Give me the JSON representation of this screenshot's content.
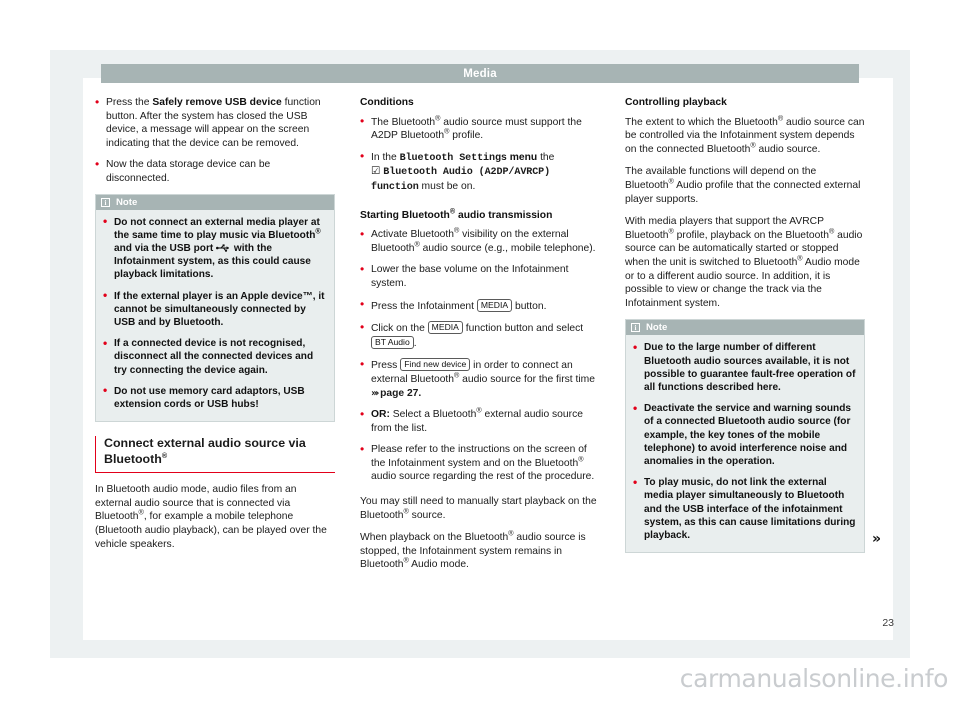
{
  "header": {
    "title": "Media"
  },
  "page_number": "23",
  "watermark": "carmanualsonline.info",
  "column_left": {
    "bullets": [
      {
        "pre": "Press the ",
        "bold": "Safely remove USB device",
        "post": " function button. After the system has closed the USB device, a message will appear on the screen indicating that the device can be removed."
      },
      {
        "pre": "Now the data storage device can be disconnected.",
        "bold": "",
        "post": ""
      }
    ],
    "note": {
      "label": "Note",
      "icon": "info-icon",
      "bullets": [
        "Do not connect an external media player at the same time to play music via Bluetooth® and via the USB port ⎇ with the Infotainment system, as this could cause playback limitations.",
        "If the external player is an Apple device™, it cannot be simultaneously connected by USB and by Bluetooth.",
        "If a connected device is not recognised, disconnect all the connected devices and try connecting the device again.",
        "Do not use memory card adaptors, USB extension cords or USB hubs!"
      ]
    },
    "section": {
      "heading": "Connect external audio source via Bluetooth®",
      "paragraph": "In Bluetooth audio mode, audio files from an external audio source that is connected via Bluetooth®, for example a mobile telephone (Bluetooth audio playback), can be played over the vehicle speakers."
    }
  },
  "column_middle": {
    "conditions_heading": "Conditions",
    "conditions_bullets": [
      "The Bluetooth® audio source must support the A2DP Bluetooth® profile.",
      "In the Bluetooth Settings menu the ☑ Bluetooth Audio (A2DP/AVRCP) function must be on."
    ],
    "menu_path": "Bluetooth Settings",
    "menu_word": "menu",
    "function_name": "Bluetooth Audio (A2DP/AVRCP)",
    "function_word": "function",
    "starting_heading": "Starting Bluetooth® audio transmission",
    "starting_bullets": [
      "Activate Bluetooth® visibility on the external Bluetooth® audio source (e.g., mobile telephone).",
      "Lower the base volume on the Infotainment system.",
      "Press the Infotainment MEDIA button.",
      "Click on the MEDIA function button and select BT Audio.",
      "Press Find new device in order to connect an external Bluetooth® audio source for the first time ➤➤➤ page 27.",
      "OR: Select a Bluetooth® external audio source from the list.",
      "Please refer to the instructions on the screen of the Infotainment system and on the Bluetooth® audio source regarding the rest of the procedure."
    ],
    "buttons": {
      "media": "MEDIA",
      "bt_audio": "BT Audio",
      "find_new_device": "Find new device"
    },
    "page_ref": "page 27",
    "or_label": "OR:",
    "paragraphs": [
      "You may still need to manually start playback on the Bluetooth® source.",
      "When playback on the Bluetooth® audio source is stopped, the Infotainment system remains in Bluetooth® Audio mode."
    ]
  },
  "column_right": {
    "heading": "Controlling playback",
    "paragraphs": [
      "The extent to which the Bluetooth® audio source can be controlled via the Infotainment system depends on the connected Bluetooth® audio source.",
      "The available functions will depend on the Bluetooth® Audio profile that the connected external player supports.",
      "With media players that support the AVRCP Bluetooth® profile, playback on the Bluetooth® audio source can be automatically started or stopped when the unit is switched to Bluetooth® Audio mode or to a different audio source. In addition, it is possible to view or change the track via the Infotainment system."
    ],
    "note": {
      "label": "Note",
      "icon": "info-icon",
      "bullets": [
        "Due to the large number of different Bluetooth audio sources available, it is not possible to guarantee fault-free operation of all functions described here.",
        "Deactivate the service and warning sounds of a connected Bluetooth audio source (for example, the key tones of the mobile telephone) to avoid interference noise and anomalies in the operation.",
        "To play music, do not link the external media player simultaneously to Bluetooth and the USB interface of the infotainment system, as this can cause limitations during playback."
      ]
    },
    "continuation_arrow": "»"
  },
  "colors": {
    "accent_red": "#e2001a",
    "header_grey": "#a7b4b4",
    "note_bg": "#e9eeee",
    "panel_bg": "#edf1f2"
  }
}
